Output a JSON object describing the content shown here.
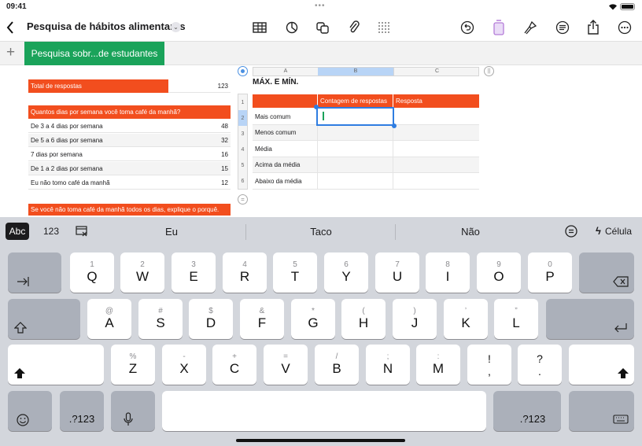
{
  "status": {
    "time": "09:41"
  },
  "toolbar": {
    "title": "Pesquisa de hábitos alimentares"
  },
  "sheet_tab": {
    "label": "Pesquisa sobr...de estudantes"
  },
  "left_table": {
    "total_label": "Total de respostas",
    "total_value": "123",
    "question": "Quantos dias por semana você toma café da manhã?",
    "rows": [
      {
        "label": "De 3 a 4 dias por semana",
        "value": "48"
      },
      {
        "label": "De 5 a 6 dias por semana",
        "value": "32"
      },
      {
        "label": "7 dias por semana",
        "value": "16"
      },
      {
        "label": "De 1 a 2 dias por semana",
        "value": "15"
      },
      {
        "label": "Eu não tomo café da manhã",
        "value": "12"
      }
    ],
    "footer": "Se você não toma café da manhã todos os dias, explique o porquê."
  },
  "right_table": {
    "columns": [
      "A",
      "B",
      "C"
    ],
    "title": "MÁX. E MÍN.",
    "header": [
      "Contagem de respostas",
      "Resposta"
    ],
    "row_numbers": [
      "1",
      "2",
      "3",
      "4",
      "5",
      "6"
    ],
    "rows": [
      "Mais comum",
      "Menos comum",
      "Média",
      "Acima da média",
      "Abaixo da média"
    ]
  },
  "keyboard": {
    "tabs": {
      "abc": "Abc",
      "num": "123",
      "cell": "Célula"
    },
    "suggestions": [
      "Eu",
      "Taco",
      "Não"
    ],
    "row1": [
      {
        "hint": "1",
        "key": "Q"
      },
      {
        "hint": "2",
        "key": "W"
      },
      {
        "hint": "3",
        "key": "E"
      },
      {
        "hint": "4",
        "key": "R"
      },
      {
        "hint": "5",
        "key": "T"
      },
      {
        "hint": "6",
        "key": "Y"
      },
      {
        "hint": "7",
        "key": "U"
      },
      {
        "hint": "8",
        "key": "I"
      },
      {
        "hint": "9",
        "key": "O"
      },
      {
        "hint": "0",
        "key": "P"
      }
    ],
    "row2": [
      {
        "hint": "@",
        "key": "A"
      },
      {
        "hint": "#",
        "key": "S"
      },
      {
        "hint": "$",
        "key": "D"
      },
      {
        "hint": "&",
        "key": "F"
      },
      {
        "hint": "*",
        "key": "G"
      },
      {
        "hint": "(",
        "key": "H"
      },
      {
        "hint": ")",
        "key": "J"
      },
      {
        "hint": "’",
        "key": "K"
      },
      {
        "hint": "”",
        "key": "L"
      }
    ],
    "row3": [
      {
        "hint": "%",
        "key": "Z"
      },
      {
        "hint": "-",
        "key": "X"
      },
      {
        "hint": "+",
        "key": "C"
      },
      {
        "hint": "=",
        "key": "V"
      },
      {
        "hint": "/",
        "key": "B"
      },
      {
        "hint": ";",
        "key": "N"
      },
      {
        "hint": ":",
        "key": "M"
      },
      {
        "hint": "!",
        "key": ","
      },
      {
        "hint": "?",
        "key": "."
      }
    ],
    "numkey": ".?123"
  }
}
